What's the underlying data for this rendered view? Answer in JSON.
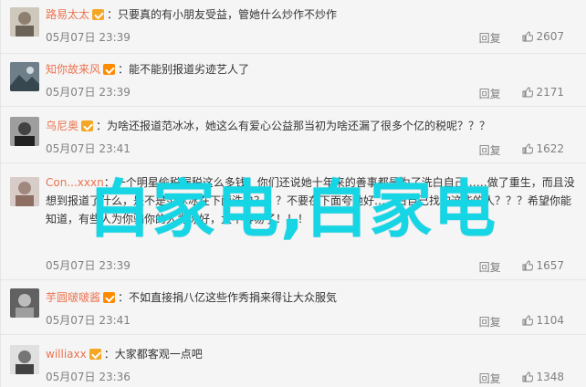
{
  "comments": [
    {
      "user": "路易太太",
      "badge": "gold",
      "text": "只要真的有小朋友受益，管她什么炒作不炒作",
      "time": "05月07日 23:39",
      "reply_label": "回复",
      "likes": "2607"
    },
    {
      "user": "知你故来风",
      "badge": "red",
      "text": "能不能别报道劣迹艺人了",
      "time": "05月07日 23:39",
      "reply_label": "回复",
      "likes": "2171"
    },
    {
      "user": "乌尼奥",
      "badge": "gold",
      "text": "为啥还报道范冰冰，她这么有爱心公益那当初为啥还漏了很多个亿的税呢？？？",
      "time": "05月07日 23:41",
      "reply_label": "回复",
      "likes": "1622"
    },
    {
      "user": "Con...xxxn",
      "badge": "",
      "text": "一个明星偷税漏税这么多钱，你们还说她十年来的善事都是为了洗白自己……做了重生，而且没想到报道了什么，是不是范冰冰在下面洗白？？？不要在下面夸她好……白自己找的这些的人？？？希望你能知道，有些人为你骗你的人为你好，太不容易了！！！",
      "time": "05月07日 23:39",
      "reply_label": "回复",
      "likes": "1657"
    },
    {
      "user": "芋圆啵啵酱",
      "badge": "red",
      "text": "不如直接捐八亿这些作秀捐来得让大众服気",
      "time": "05月07日 23:41",
      "reply_label": "回复",
      "likes": "1104"
    },
    {
      "user": "williaxx",
      "badge": "gold",
      "text": "大家都客观一点吧",
      "time": "05月07日 23:36",
      "reply_label": "回复",
      "likes": "1348"
    }
  ],
  "watermark": "白家电,白家电",
  "separator": "："
}
